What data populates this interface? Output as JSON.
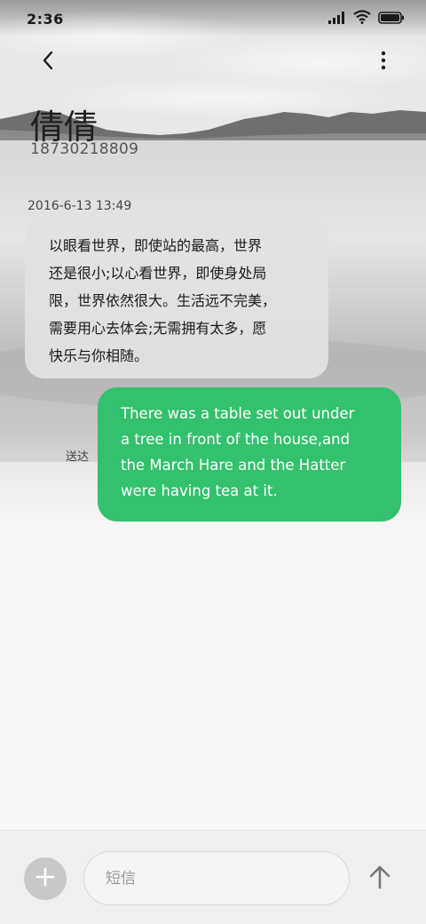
{
  "status_bar": {
    "time": "2:36",
    "icons": [
      "signal-icon",
      "wifi-icon",
      "battery-icon"
    ]
  },
  "nav": {
    "back_icon": "back-arrow-icon",
    "more_icon": "more-vertical-icon"
  },
  "contact": {
    "name": "倩倩",
    "number": "18730218809"
  },
  "conversation": {
    "timestamp": "2016-6-13 13:49",
    "messages": [
      {
        "direction": "incoming",
        "lines": [
          "以眼看世界，即使站的最高，世界",
          "还是很小;以心看世界，即使身处局",
          "限，世界依然很大。生活远不完美，",
          "需要用心去体会;无需拥有太多，愿",
          "快乐与你相随。"
        ]
      },
      {
        "direction": "outgoing",
        "lines": [
          "There was a table set out under",
          "a tree in front of the house,and",
          "the March Hare and the Hatter",
          "were having tea at it."
        ],
        "status": "送达"
      }
    ]
  },
  "composer": {
    "add_icon": "plus-icon",
    "placeholder": "短信",
    "value": "",
    "send_icon": "arrow-up-icon"
  },
  "colors": {
    "outgoing_bubble": "#34c16d",
    "incoming_bubble": "#e2e2e2",
    "composer_bg": "#efefef",
    "add_button": "#c8c8c8"
  }
}
